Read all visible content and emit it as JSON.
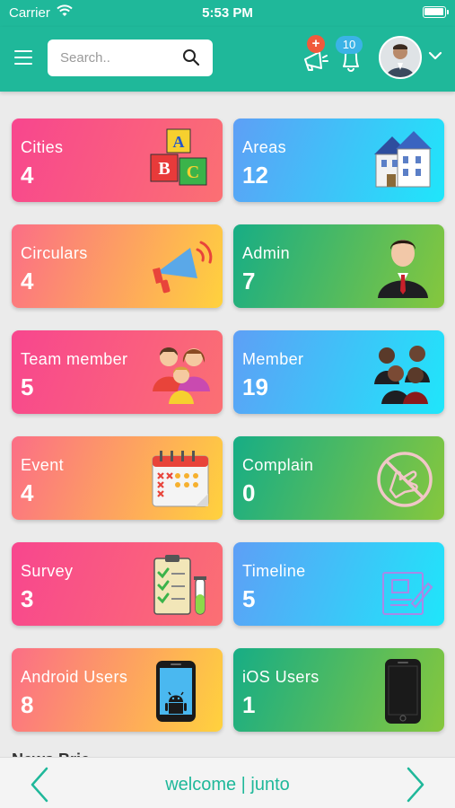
{
  "status_bar": {
    "carrier": "Carrier",
    "time": "5:53 PM",
    "battery_level": 1.0
  },
  "header": {
    "menu_icon": "hamburger-icon",
    "search": {
      "placeholder": "Search..",
      "value": ""
    },
    "announcement_badge": "+",
    "notification_count": "10",
    "avatar_icon": "user-avatar",
    "dropdown_icon": "chevron-down-icon"
  },
  "cards": [
    {
      "label": "Cities",
      "count": "4",
      "icon": "abc-blocks-icon",
      "theme": "pink"
    },
    {
      "label": "Areas",
      "count": "12",
      "icon": "building-icon",
      "theme": "blue"
    },
    {
      "label": "Circulars",
      "count": "4",
      "icon": "megaphone-icon",
      "theme": "orange"
    },
    {
      "label": "Admin",
      "count": "7",
      "icon": "businessman-icon",
      "theme": "green"
    },
    {
      "label": "Team member",
      "count": "5",
      "icon": "family-icon",
      "theme": "pink"
    },
    {
      "label": "Member",
      "count": "19",
      "icon": "group-icon",
      "theme": "blue"
    },
    {
      "label": "Event",
      "count": "4",
      "icon": "calendar-icon",
      "theme": "orange"
    },
    {
      "label": "Complain",
      "count": "0",
      "icon": "complain-hand-icon",
      "theme": "green"
    },
    {
      "label": "Survey",
      "count": "3",
      "icon": "clipboard-checklist-icon",
      "theme": "pink"
    },
    {
      "label": "Timeline",
      "count": "5",
      "icon": "document-sign-icon",
      "theme": "blue"
    },
    {
      "label": "Android Users",
      "count": "8",
      "icon": "android-phone-icon",
      "theme": "orange"
    },
    {
      "label": "iOS Users",
      "count": "1",
      "icon": "iphone-icon",
      "theme": "green"
    }
  ],
  "section_peek": "News Brie",
  "bottom_bar": {
    "text": "welcome | junto",
    "prev_icon": "chevron-left-icon",
    "next_icon": "chevron-right-icon"
  },
  "colors": {
    "primary": "#1fb89a",
    "pink": "#f8468e",
    "blue": "#1fe6fa",
    "green": "#17ad85",
    "orange": "#ffd23d"
  }
}
